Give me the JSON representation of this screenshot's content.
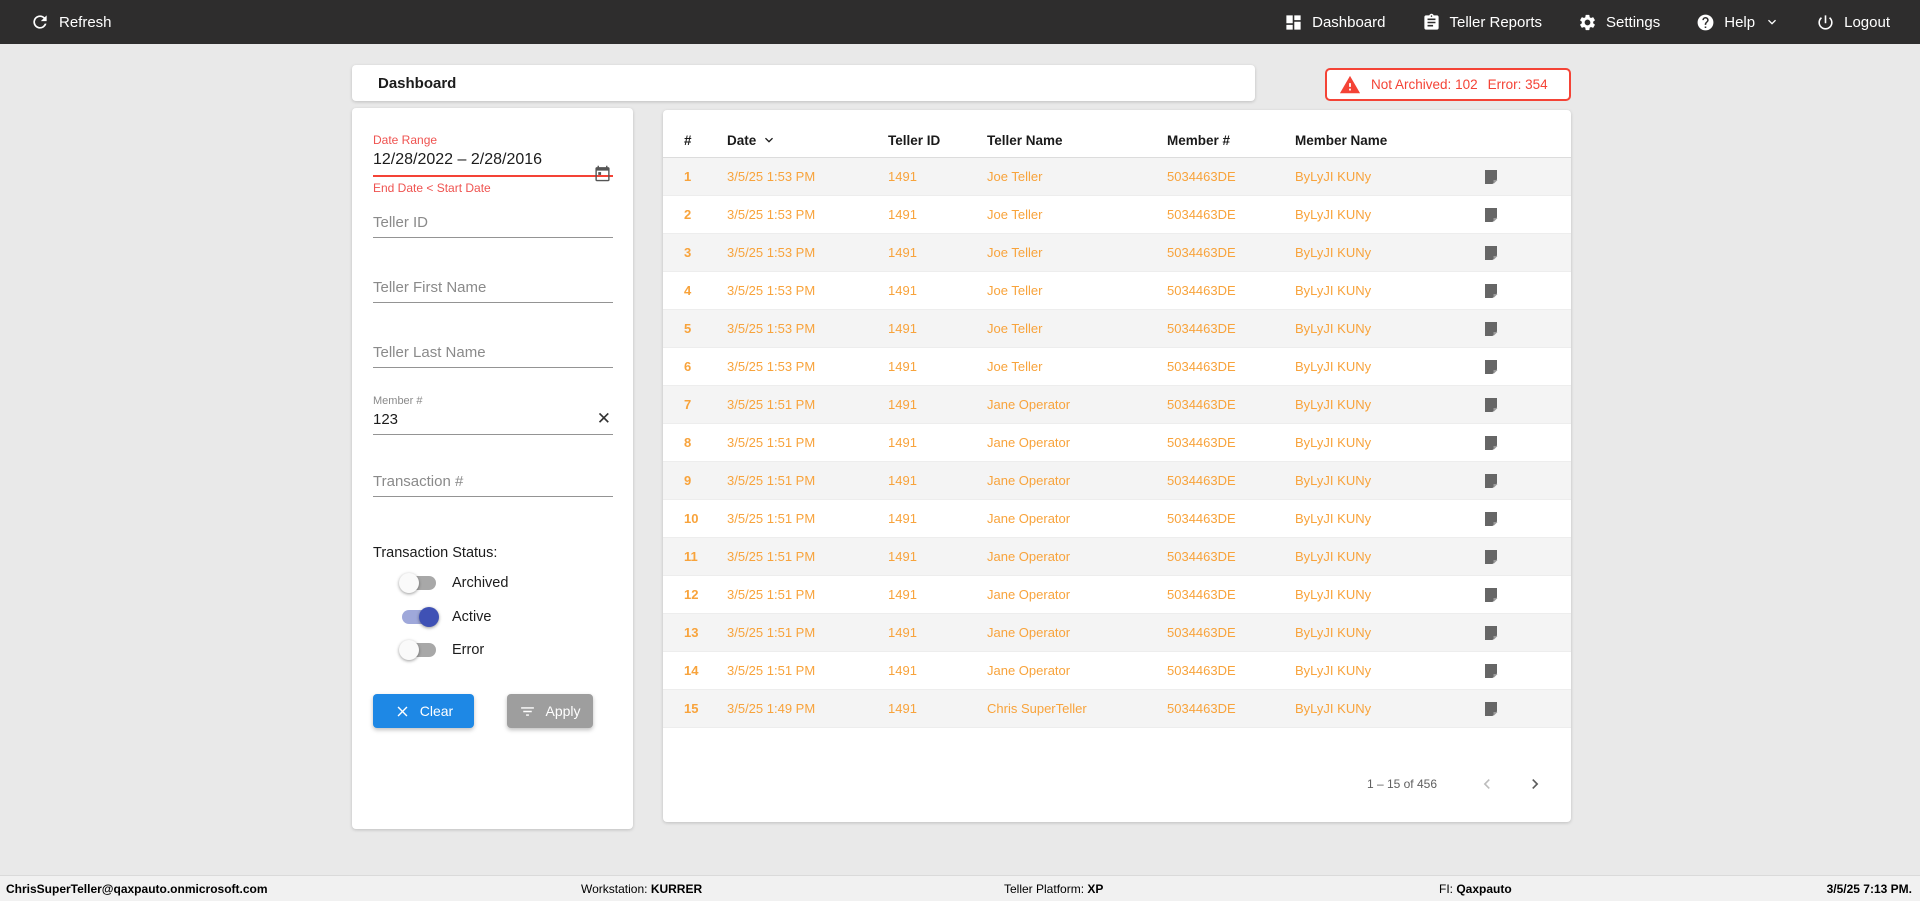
{
  "colors": {
    "accent_orange": "#F8A33B",
    "error_red": "#F44336",
    "button_blue": "#1E88E5",
    "button_gray": "#9E9E9E",
    "toggle_on_indigo": "#3F51B5",
    "topbar_dark": "#2E2D2D"
  },
  "topbar": {
    "refresh_label": "Refresh",
    "items": [
      {
        "label": "Dashboard"
      },
      {
        "label": "Teller Reports"
      },
      {
        "label": "Settings"
      },
      {
        "label": "Help"
      },
      {
        "label": "Logout"
      }
    ]
  },
  "header": {
    "title": "Dashboard",
    "alert": {
      "not_archived_label": "Not Archived:",
      "not_archived_count": "102",
      "error_label": "Error:",
      "error_count": "354"
    }
  },
  "filters": {
    "date_range": {
      "label": "Date Range",
      "value": "12/28/2022 – 2/28/2016",
      "error": "End Date < Start Date"
    },
    "teller_id_placeholder": "Teller ID",
    "teller_first_name_placeholder": "Teller First Name",
    "teller_last_name_placeholder": "Teller Last Name",
    "member_number": {
      "label": "Member #",
      "value": "123"
    },
    "transaction_placeholder": "Transaction #",
    "status_label": "Transaction Status:",
    "statuses": [
      {
        "label": "Archived",
        "on": false
      },
      {
        "label": "Active",
        "on": true
      },
      {
        "label": "Error",
        "on": false
      }
    ],
    "clear_label": "Clear",
    "apply_label": "Apply"
  },
  "table": {
    "columns": [
      "#",
      "Date",
      "Teller ID",
      "Teller Name",
      "Member #",
      "Member Name"
    ],
    "rows": [
      {
        "num": "1",
        "date": "3/5/25 1:53 PM",
        "teller_id": "1491",
        "teller_name": "Joe Teller",
        "member_num": "5034463DE",
        "member_name": "ByLyJI KUNy"
      },
      {
        "num": "2",
        "date": "3/5/25 1:53 PM",
        "teller_id": "1491",
        "teller_name": "Joe Teller",
        "member_num": "5034463DE",
        "member_name": "ByLyJI KUNy"
      },
      {
        "num": "3",
        "date": "3/5/25 1:53 PM",
        "teller_id": "1491",
        "teller_name": "Joe Teller",
        "member_num": "5034463DE",
        "member_name": "ByLyJI KUNy"
      },
      {
        "num": "4",
        "date": "3/5/25 1:53 PM",
        "teller_id": "1491",
        "teller_name": "Joe Teller",
        "member_num": "5034463DE",
        "member_name": "ByLyJI KUNy"
      },
      {
        "num": "5",
        "date": "3/5/25 1:53 PM",
        "teller_id": "1491",
        "teller_name": "Joe Teller",
        "member_num": "5034463DE",
        "member_name": "ByLyJI KUNy"
      },
      {
        "num": "6",
        "date": "3/5/25 1:53 PM",
        "teller_id": "1491",
        "teller_name": "Joe Teller",
        "member_num": "5034463DE",
        "member_name": "ByLyJI KUNy"
      },
      {
        "num": "7",
        "date": "3/5/25 1:51 PM",
        "teller_id": "1491",
        "teller_name": "Jane Operator",
        "member_num": "5034463DE",
        "member_name": "ByLyJI KUNy"
      },
      {
        "num": "8",
        "date": "3/5/25 1:51 PM",
        "teller_id": "1491",
        "teller_name": "Jane Operator",
        "member_num": "5034463DE",
        "member_name": "ByLyJI KUNy"
      },
      {
        "num": "9",
        "date": "3/5/25 1:51 PM",
        "teller_id": "1491",
        "teller_name": "Jane Operator",
        "member_num": "5034463DE",
        "member_name": "ByLyJI KUNy"
      },
      {
        "num": "10",
        "date": "3/5/25 1:51 PM",
        "teller_id": "1491",
        "teller_name": "Jane Operator",
        "member_num": "5034463DE",
        "member_name": "ByLyJI KUNy"
      },
      {
        "num": "11",
        "date": "3/5/25 1:51 PM",
        "teller_id": "1491",
        "teller_name": "Jane Operator",
        "member_num": "5034463DE",
        "member_name": "ByLyJI KUNy"
      },
      {
        "num": "12",
        "date": "3/5/25 1:51 PM",
        "teller_id": "1491",
        "teller_name": "Jane Operator",
        "member_num": "5034463DE",
        "member_name": "ByLyJI KUNy"
      },
      {
        "num": "13",
        "date": "3/5/25 1:51 PM",
        "teller_id": "1491",
        "teller_name": "Jane Operator",
        "member_num": "5034463DE",
        "member_name": "ByLyJI KUNy"
      },
      {
        "num": "14",
        "date": "3/5/25 1:51 PM",
        "teller_id": "1491",
        "teller_name": "Jane Operator",
        "member_num": "5034463DE",
        "member_name": "ByLyJI KUNy"
      },
      {
        "num": "15",
        "date": "3/5/25 1:49 PM",
        "teller_id": "1491",
        "teller_name": "Chris SuperTeller",
        "member_num": "5034463DE",
        "member_name": "ByLyJI KUNy"
      }
    ],
    "pagination": {
      "range_text": "1 – 15 of 456"
    }
  },
  "statusbar": {
    "user": "ChrisSuperTeller@qaxpauto.onmicrosoft.com",
    "workstation_label": "Workstation:",
    "workstation": "KURRER",
    "platform_label": "Teller Platform:",
    "platform": "XP",
    "fi_label": "FI:",
    "fi": "Qaxpauto",
    "datetime": "3/5/25 7:13 PM."
  }
}
